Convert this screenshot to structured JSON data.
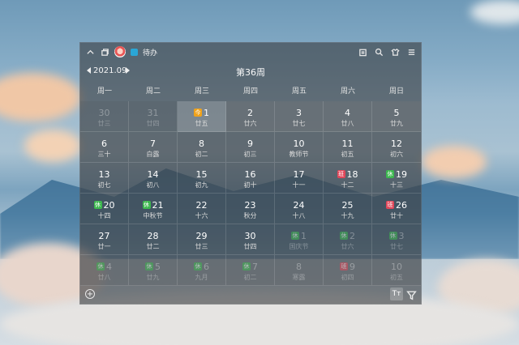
{
  "header": {
    "todo_label": "待办"
  },
  "nav": {
    "month": "2021.09",
    "week": "第36周"
  },
  "weekdays": [
    "周一",
    "周二",
    "周三",
    "周四",
    "周五",
    "周六",
    "周日"
  ],
  "cells": [
    {
      "d": "30",
      "l": "廿三",
      "other": true
    },
    {
      "d": "31",
      "l": "廿四",
      "other": true
    },
    {
      "d": "1",
      "l": "廿五",
      "tag": "今",
      "tagType": "today-tag",
      "today": true
    },
    {
      "d": "2",
      "l": "廿六",
      "weekhi": true
    },
    {
      "d": "3",
      "l": "廿七",
      "weekhi": true
    },
    {
      "d": "4",
      "l": "廿八",
      "weekhi": true
    },
    {
      "d": "5",
      "l": "廿九",
      "weekhi": true
    },
    {
      "d": "6",
      "l": "三十"
    },
    {
      "d": "7",
      "l": "白露"
    },
    {
      "d": "8",
      "l": "初二"
    },
    {
      "d": "9",
      "l": "初三"
    },
    {
      "d": "10",
      "l": "教师节"
    },
    {
      "d": "11",
      "l": "初五"
    },
    {
      "d": "12",
      "l": "初六"
    },
    {
      "d": "13",
      "l": "初七"
    },
    {
      "d": "14",
      "l": "初八"
    },
    {
      "d": "15",
      "l": "初九"
    },
    {
      "d": "16",
      "l": "初十"
    },
    {
      "d": "17",
      "l": "十一"
    },
    {
      "d": "18",
      "l": "十二",
      "tag": "班",
      "tagType": "work"
    },
    {
      "d": "19",
      "l": "十三",
      "tag": "休",
      "tagType": "rest"
    },
    {
      "d": "20",
      "l": "十四",
      "tag": "休",
      "tagType": "rest"
    },
    {
      "d": "21",
      "l": "中秋节",
      "tag": "休",
      "tagType": "rest"
    },
    {
      "d": "22",
      "l": "十六"
    },
    {
      "d": "23",
      "l": "秋分"
    },
    {
      "d": "24",
      "l": "十八"
    },
    {
      "d": "25",
      "l": "十九"
    },
    {
      "d": "26",
      "l": "廿十",
      "tag": "班",
      "tagType": "work"
    },
    {
      "d": "27",
      "l": "廿一"
    },
    {
      "d": "28",
      "l": "廿二"
    },
    {
      "d": "29",
      "l": "廿三"
    },
    {
      "d": "30",
      "l": "廿四"
    },
    {
      "d": "1",
      "l": "国庆节",
      "tag": "休",
      "tagType": "rest",
      "other": true
    },
    {
      "d": "2",
      "l": "廿六",
      "tag": "休",
      "tagType": "rest",
      "other": true
    },
    {
      "d": "3",
      "l": "廿七",
      "tag": "休",
      "tagType": "rest",
      "other": true
    },
    {
      "d": "4",
      "l": "廿八",
      "tag": "休",
      "tagType": "rest",
      "other": true
    },
    {
      "d": "5",
      "l": "廿九",
      "tag": "休",
      "tagType": "rest",
      "other": true
    },
    {
      "d": "6",
      "l": "九月",
      "tag": "休",
      "tagType": "rest",
      "other": true
    },
    {
      "d": "7",
      "l": "初二",
      "tag": "休",
      "tagType": "rest",
      "other": true
    },
    {
      "d": "8",
      "l": "寒露",
      "other": true
    },
    {
      "d": "9",
      "l": "初四",
      "tag": "班",
      "tagType": "work",
      "other": true
    },
    {
      "d": "10",
      "l": "初五",
      "other": true
    }
  ],
  "footer": {
    "font_label": "Tт"
  }
}
